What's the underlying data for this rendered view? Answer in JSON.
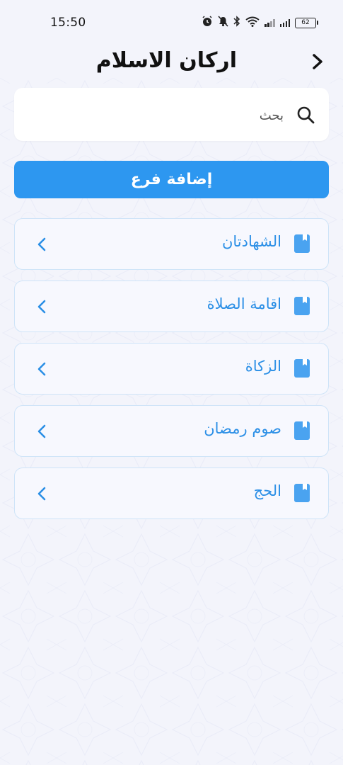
{
  "status_bar": {
    "time": "15:50",
    "battery": "62"
  },
  "header": {
    "title": "اركان الاسلام",
    "back_icon": "chevron-right-icon"
  },
  "search": {
    "placeholder": "بحث",
    "icon": "search-icon"
  },
  "add_button": {
    "label": "إضافة فرع",
    "color": "#2d97f0"
  },
  "list": {
    "accent": "#2b8fe6",
    "items": [
      {
        "label": "الشهادتان",
        "icon": "book-icon"
      },
      {
        "label": "اقامة الصلاة",
        "icon": "book-icon"
      },
      {
        "label": "الزكاة",
        "icon": "book-icon"
      },
      {
        "label": "صوم رمضان",
        "icon": "book-icon"
      },
      {
        "label": "الحج",
        "icon": "book-icon"
      }
    ]
  }
}
